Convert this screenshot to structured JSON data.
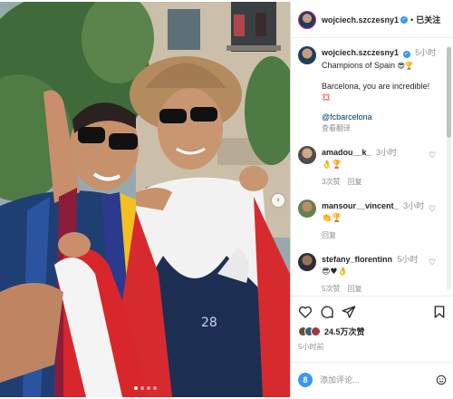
{
  "post": {
    "author": "wojciech.szczesny1",
    "verified_glyph": "✓",
    "separator": "•",
    "follow_status": "已关注",
    "caption_time": "5小时",
    "caption_line1": "Champions of Spain",
    "caption_line1_emoji": "😎🏆",
    "caption_line2": "Barcelona, you are incredible!",
    "caption_line2_emoji": "💢",
    "mention": "@fcbarcelona",
    "see_translation": "查看翻译",
    "likes": "24.5万次赞",
    "post_time": "5小时前"
  },
  "comments": [
    {
      "user": "amadou__k_",
      "time": "3小时",
      "text": "👌🏆",
      "likes": "3次赞",
      "reply": "回复"
    },
    {
      "user": "mansour__vincent_",
      "time": "3小时",
      "text": "👏🏆",
      "likes": "",
      "reply": "回复"
    },
    {
      "user": "stefany_florentinn",
      "time": "5小时",
      "text": "😎♥👌",
      "likes": "5次赞",
      "reply": "回复"
    }
  ],
  "composer": {
    "avatar_letter": "8",
    "placeholder": "添加评论..."
  },
  "icons": {
    "carousel_next": "chevron-right-icon",
    "like": "heart-icon",
    "comment": "comment-icon",
    "share": "share-icon",
    "save": "bookmark-icon",
    "emoji": "smiley-icon"
  },
  "colors": {
    "verified": "#3897f0",
    "story_ring": "#d62976",
    "muted_text": "#8e8e8e",
    "link": "#00376b"
  }
}
